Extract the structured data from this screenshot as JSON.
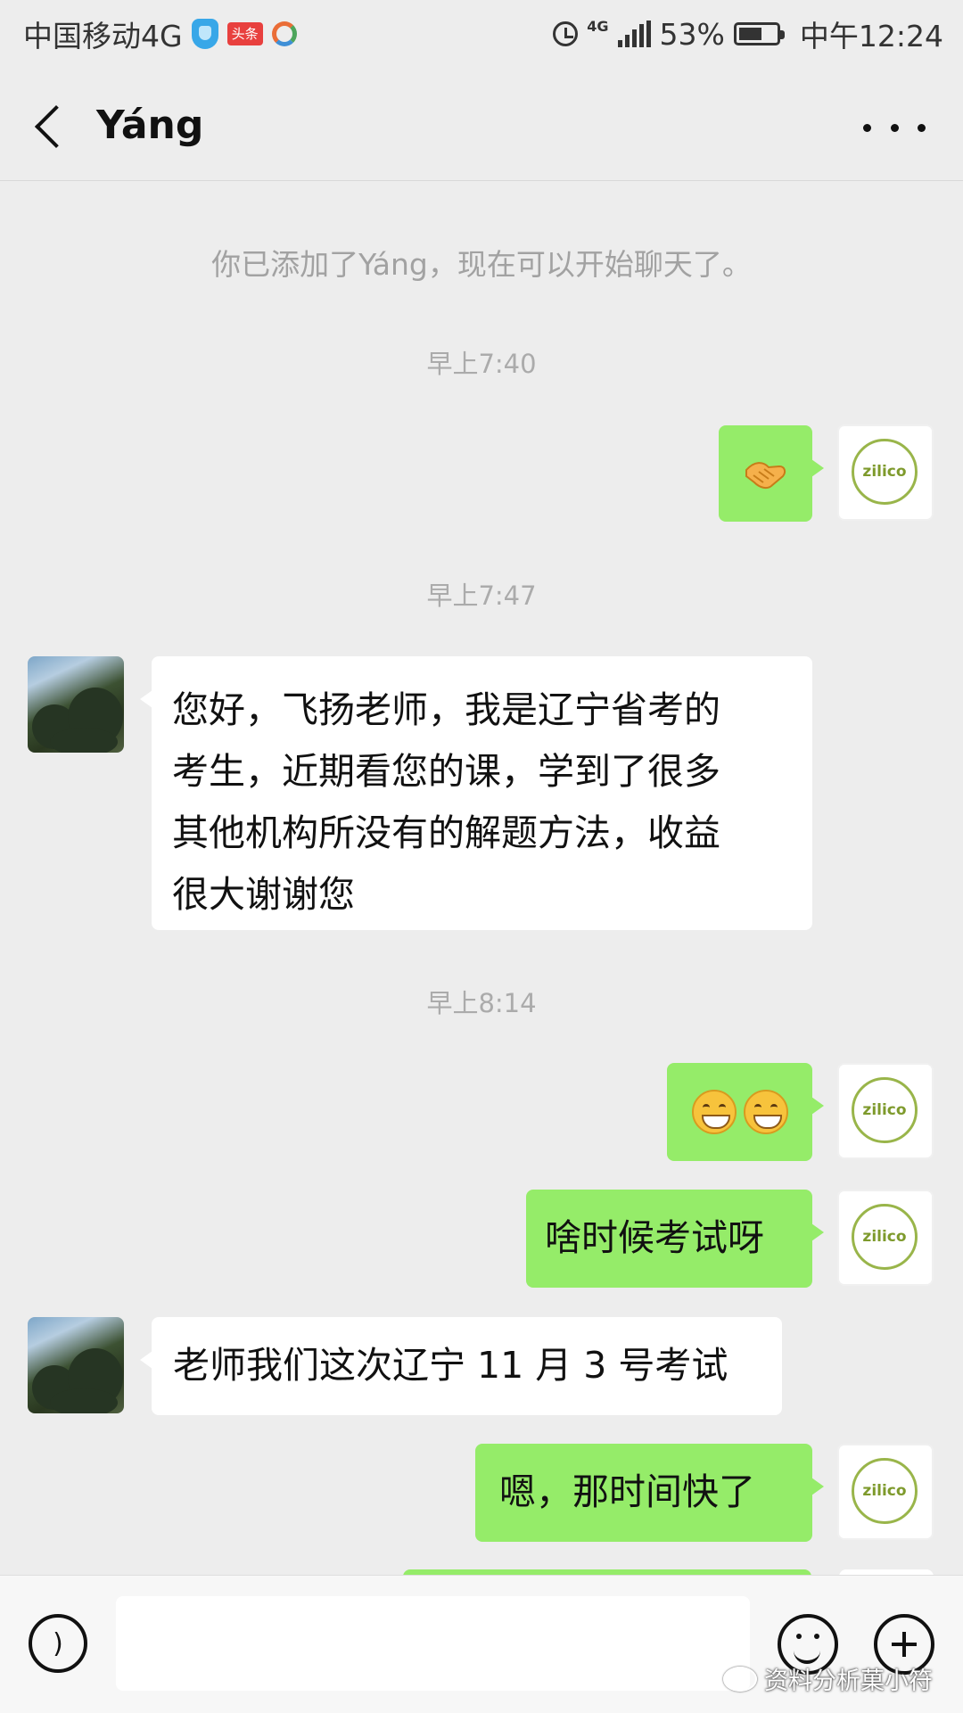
{
  "status_bar": {
    "carrier": "中国移动4G",
    "toutiao_badge": "头条",
    "network": "4G",
    "battery": "53%",
    "time": "中午12:24"
  },
  "header": {
    "title": "Yáng"
  },
  "chat": {
    "system_notice": "你已添加了Yáng，现在可以开始聊天了。",
    "timestamps": [
      "早上7:40",
      "早上7:47",
      "早上8:14"
    ],
    "messages": [
      {
        "side": "out",
        "content": "handshake-emoji"
      },
      {
        "side": "in",
        "text_lines": [
          "您好，飞扬老师，我是辽宁省考的",
          "考生，近期看您的课，学到了很多",
          "其他机构所没有的解题方法，收益",
          "很大谢谢您"
        ]
      },
      {
        "side": "out",
        "content": "grin-emoji ×2"
      },
      {
        "side": "out",
        "text": "啥时候考试呀"
      },
      {
        "side": "in",
        "text": "老师我们这次辽宁 11 月 3 号考试"
      },
      {
        "side": "out",
        "text": "嗯，那时间快了"
      }
    ],
    "my_avatar_text": "zilico"
  },
  "input_bar": {
    "watermark": "资料分析菓小符"
  },
  "colors": {
    "outgoing_bubble": "#95ec69",
    "incoming_bubble": "#ffffff",
    "background": "#ededed"
  }
}
